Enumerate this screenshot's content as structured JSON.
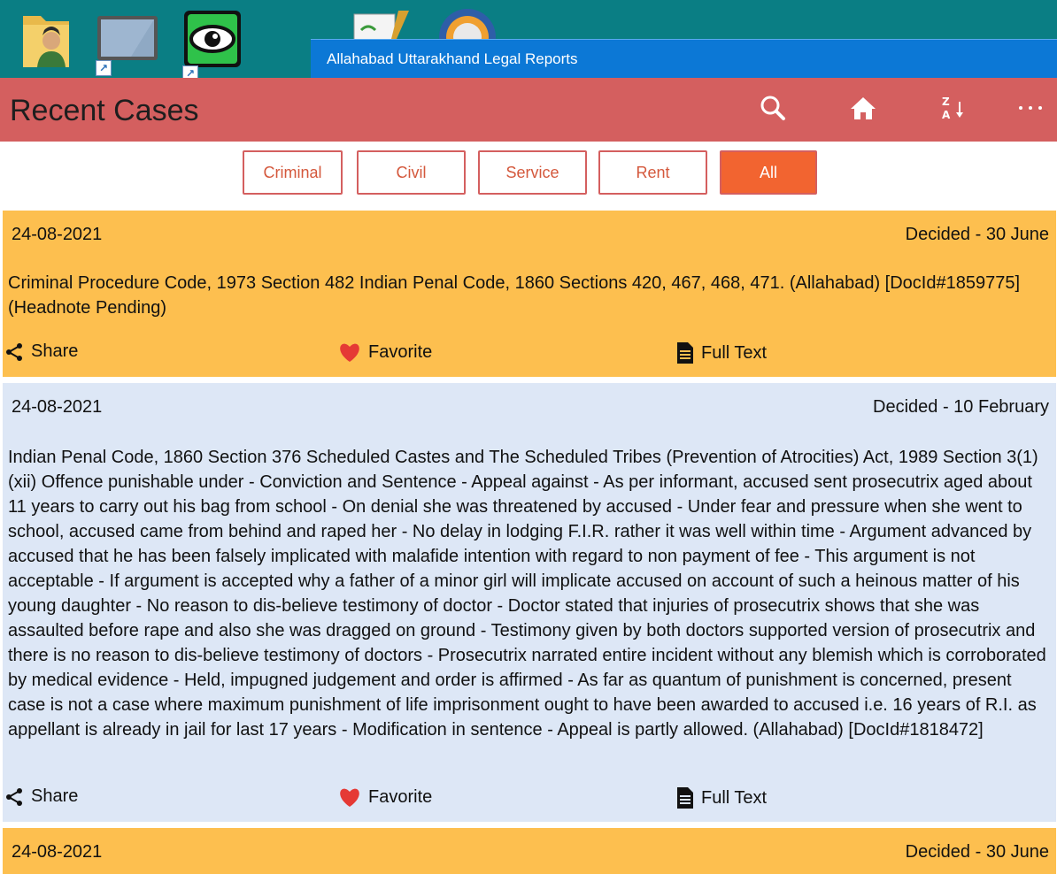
{
  "window": {
    "title": "Allahabad Uttarakhand Legal Reports"
  },
  "desktop": {
    "icons": [
      "user-folder-icon",
      "monitor-shortcut-icon",
      "eye-app-shortcut-icon",
      "notepad-icon",
      "compass-icon"
    ]
  },
  "header": {
    "title": "Recent Cases",
    "icons": [
      "search-icon",
      "home-icon",
      "sort-az-icon",
      "more-icon"
    ]
  },
  "filters": {
    "items": [
      "Criminal",
      "Civil",
      "Service",
      "Rent",
      "All"
    ],
    "active": "All"
  },
  "colors": {
    "header": "#d45f5f",
    "active_filter": "#f26430",
    "card_orange": "#fdbf4f",
    "card_blue": "#dde7f6",
    "titlebar": "#0c78d6",
    "desktop": "#0a7e84"
  },
  "actions": {
    "share": "Share",
    "favorite": "Favorite",
    "full_text": "Full Text"
  },
  "cases": [
    {
      "date": "24-08-2021",
      "decided": "Decided - 30 June",
      "text": "Criminal Procedure Code, 1973 Section 482 Indian Penal Code, 1860 Sections 420, 467, 468, 471. (Allahabad) [DocId#1859775] (Headnote Pending)"
    },
    {
      "date": "24-08-2021",
      "decided": "Decided - 10 February",
      "text": "Indian Penal Code, 1860 Section 376 Scheduled Castes and The Scheduled Tribes (Prevention of Atrocities) Act, 1989 Section 3(1)(xii) Offence punishable under - Conviction and Sentence - Appeal against - As per informant, accused sent prosecutrix aged about 11 years to carry out his bag from school - On denial she was threatened by accused - Under fear and pressure when she went to school, accused came from behind and raped her - No delay in lodging F.I.R. rather it was well within time - Argument advanced by accused that he has been falsely implicated with malafide intention with regard to non payment of fee - This argument is not acceptable - If argument is accepted why a father of a minor girl will implicate accused on account of such a heinous matter of his young daughter - No reason to dis-believe testimony of doctor - Doctor stated that injuries of prosecutrix shows that she was assaulted before rape and also she was dragged on ground - Testimony given by both doctors supported version of prosecutrix and there is no reason to dis-believe testimony of doctors - Prosecutrix narrated entire incident without any blemish which is corroborated by medical evidence - Held, impugned judgement and order is affirmed - As far as quantum of punishment is concerned, present case is not a case where maximum punishment of life imprisonment ought to have been awarded to accused i.e. 16 years of R.I. as appellant is already in jail for last 17 years - Modification in sentence - Appeal is partly allowed. (Allahabad) [DocId#1818472]"
    },
    {
      "date": "24-08-2021",
      "decided": "Decided - 30 June"
    }
  ]
}
